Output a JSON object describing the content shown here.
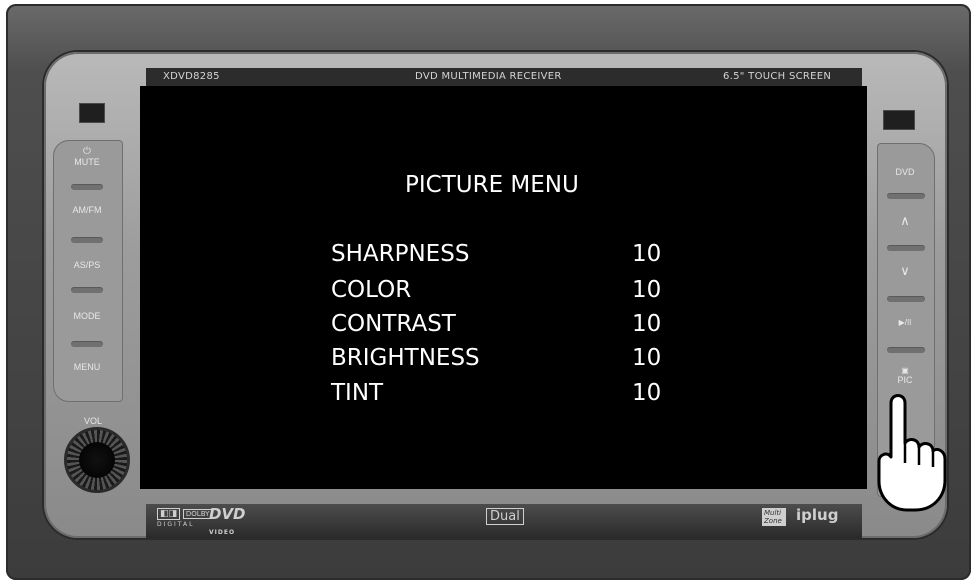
{
  "device": {
    "model": "XDVD8285",
    "description": "DVD MULTIMEDIA RECEIVER",
    "screen_size": "6.5\" TOUCH SCREEN",
    "brand": "Dual",
    "logos": {
      "dolby": "DOLBY",
      "dolby_sub": "DIGITAL",
      "dvd": "DVD",
      "dvd_sub": "VIDEO",
      "multizone": "Multi Zone",
      "iplug": "iplug"
    }
  },
  "left_buttons": [
    {
      "icon": "power-icon",
      "label": "MUTE"
    },
    {
      "label": "AM/FM"
    },
    {
      "label": "AS/PS"
    },
    {
      "label": "MODE"
    },
    {
      "label": "MENU"
    }
  ],
  "volume_label": "VOL",
  "right_buttons": [
    {
      "label": "DVD"
    },
    {
      "icon": "chevron-up-icon",
      "glyph": "∧"
    },
    {
      "icon": "chevron-down-icon",
      "glyph": "∨"
    },
    {
      "icon": "play-pause-icon",
      "glyph": "▶/II"
    },
    {
      "icon": "picture-icon",
      "label": "PIC"
    }
  ],
  "menu": {
    "title": "PICTURE MENU",
    "rows": [
      {
        "label": "SHARPNESS",
        "value": "10"
      },
      {
        "label": "COLOR",
        "value": "10"
      },
      {
        "label": "CONTRAST",
        "value": "10"
      },
      {
        "label": "BRIGHTNESS",
        "value": "10"
      },
      {
        "label": "TINT",
        "value": "10"
      }
    ]
  },
  "colors": {
    "screen": "#000000",
    "menu_text": "#ffffff",
    "bezel": "#9d9d9d",
    "frame": "#3c3c3c"
  }
}
